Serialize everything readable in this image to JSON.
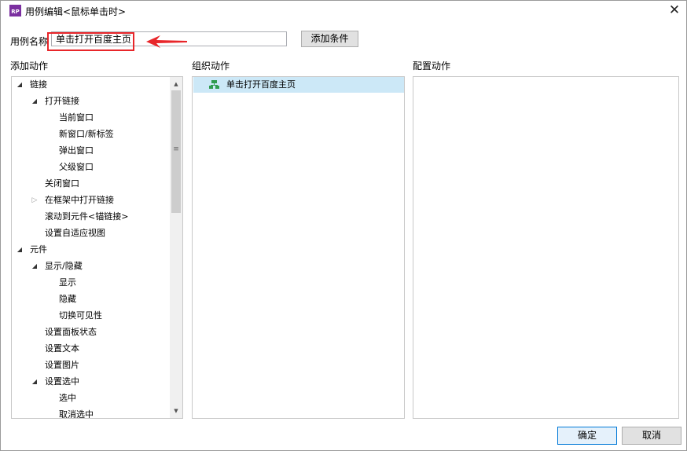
{
  "window": {
    "title": "用例编辑<鼠标单击时>",
    "app_icon_text": "RP",
    "close_glyph": "✕"
  },
  "case_name": {
    "label": "用例名称",
    "value": "单击打开百度主页"
  },
  "add_condition_button": "添加条件",
  "sections": {
    "add_action": "添加动作",
    "organize_action": "组织动作",
    "configure_action": "配置动作"
  },
  "action_tree": [
    {
      "label": "链接",
      "level": 0,
      "toggle": "open"
    },
    {
      "label": "打开链接",
      "level": 1,
      "toggle": "open"
    },
    {
      "label": "当前窗口",
      "level": 2
    },
    {
      "label": "新窗口/新标签",
      "level": 2
    },
    {
      "label": "弹出窗口",
      "level": 2
    },
    {
      "label": "父级窗口",
      "level": 2
    },
    {
      "label": "关闭窗口",
      "level": 1
    },
    {
      "label": "在框架中打开链接",
      "level": 1,
      "toggle": "closed"
    },
    {
      "label": "滚动到元件<锚链接>",
      "level": 1
    },
    {
      "label": "设置自适应视图",
      "level": 1
    },
    {
      "label": "元件",
      "level": 0,
      "toggle": "open"
    },
    {
      "label": "显示/隐藏",
      "level": 1,
      "toggle": "open"
    },
    {
      "label": "显示",
      "level": 2
    },
    {
      "label": "隐藏",
      "level": 2
    },
    {
      "label": "切换可见性",
      "level": 2
    },
    {
      "label": "设置面板状态",
      "level": 1
    },
    {
      "label": "设置文本",
      "level": 1
    },
    {
      "label": "设置图片",
      "level": 1
    },
    {
      "label": "设置选中",
      "level": 1,
      "toggle": "open"
    },
    {
      "label": "选中",
      "level": 2
    },
    {
      "label": "取消选中",
      "level": 2
    }
  ],
  "organized_actions": [
    {
      "label": "单击打开百度主页",
      "icon": "case-flow-icon"
    }
  ],
  "footer": {
    "ok": "确定",
    "cancel": "取消"
  },
  "colors": {
    "highlight": "#e8262a",
    "selected_row": "#cce8f7",
    "primary_border": "#0078d7",
    "icon_green": "#2e9c4f"
  }
}
